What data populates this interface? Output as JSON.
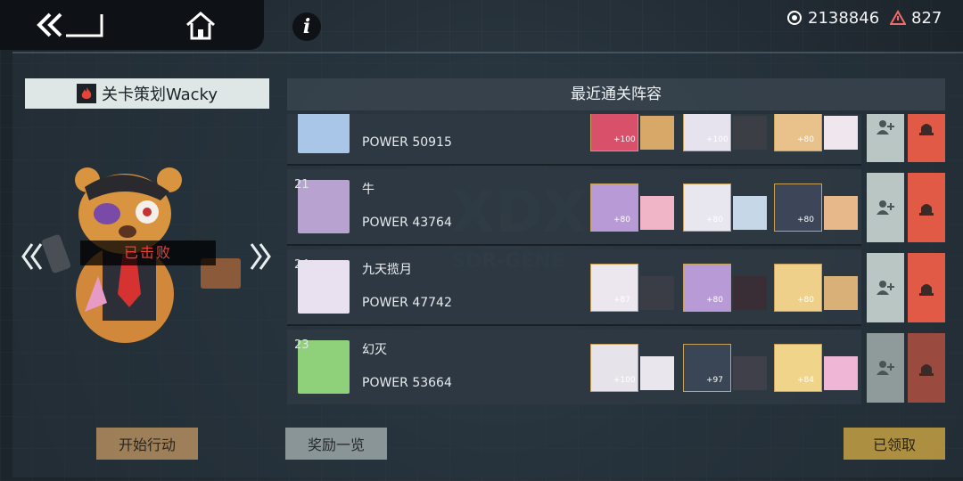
{
  "currency": {
    "primary": {
      "icon": "gear-currency-icon",
      "value": "2138846"
    },
    "secondary": {
      "icon": "warning-triangle-icon",
      "value": "827"
    }
  },
  "stage": {
    "title": "关卡策划Wacky",
    "status": "已击败"
  },
  "panel": {
    "title": "最近通关阵容"
  },
  "entries": [
    {
      "rank": "",
      "name": "",
      "power": "POWER 50915",
      "avatar_color": "#a9c6e8"
    },
    {
      "rank": "21",
      "name": "牛",
      "power": "POWER 43764",
      "avatar_color": "#b8a2cf"
    },
    {
      "rank": "24",
      "name": "九天揽月",
      "power": "POWER 47742",
      "avatar_color": "#e9e1ef"
    },
    {
      "rank": "23",
      "name": "幻灭",
      "power": "POWER 53664",
      "avatar_color": "#8fd17a"
    }
  ],
  "team_levels": [
    [
      "+100",
      "+100",
      "+80"
    ],
    [
      "+80",
      "+80",
      "+80"
    ],
    [
      "+87",
      "+80",
      "+80"
    ],
    [
      "+100",
      "+97",
      "+84"
    ]
  ],
  "buttons": {
    "start": "开始行动",
    "rewards": "奖励一览",
    "claimed": "已领取"
  },
  "colors": {
    "accent_red": "#e05a46",
    "accent_gold": "#c6a043",
    "panel": "#2e3842"
  }
}
